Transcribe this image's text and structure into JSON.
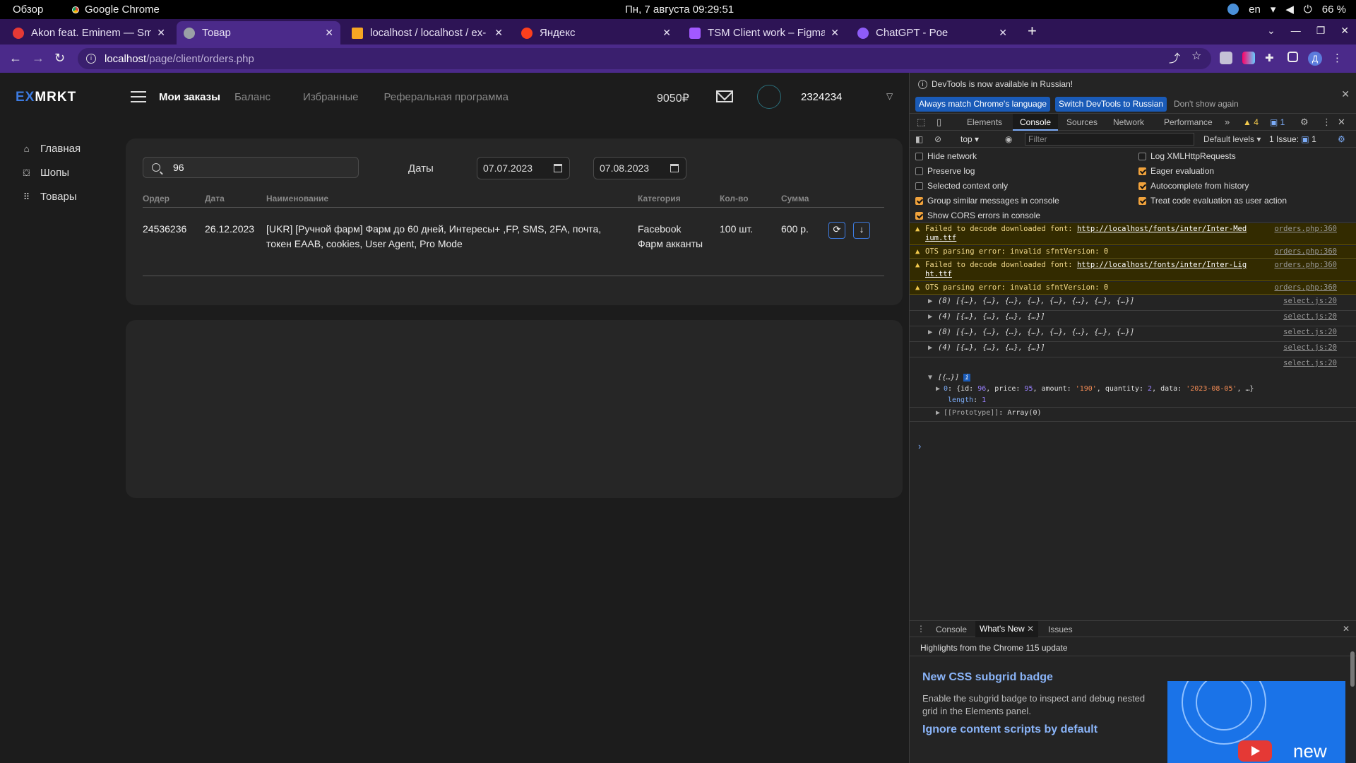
{
  "os": {
    "overview": "Обзор",
    "app_name": "Google Chrome",
    "clock": "Пн, 7 августа  09:29:51",
    "lang": "en",
    "battery": "66 %"
  },
  "tabs": [
    {
      "title": "Akon feat. Eminem — Sm",
      "favicon_color": "#e53935"
    },
    {
      "title": "Товар",
      "favicon_color": "#9aa0a6"
    },
    {
      "title": "localhost / localhost / ex-",
      "favicon_color": "#f6a623"
    },
    {
      "title": "Яндекс",
      "favicon_color": "#fc3f1d"
    },
    {
      "title": "TSM Client work – Figma",
      "favicon_color": "#a259ff"
    },
    {
      "title": "ChatGPT - Poe",
      "favicon_color": "#8e5cf7"
    }
  ],
  "address": {
    "host": "localhost",
    "path": "/page/client/orders.php"
  },
  "site": {
    "logo_ex": "EX",
    "logo_rest": "MRKT",
    "nav": [
      "Мои заказы",
      "Баланс",
      "Избранные",
      "Реферальная программа"
    ],
    "balance": "9050₽",
    "username": "2324234",
    "sidebar": [
      {
        "label": "Главная",
        "icon": "home-icon"
      },
      {
        "label": "Шопы",
        "icon": "bag-icon"
      },
      {
        "label": "Товары",
        "icon": "grid-icon"
      }
    ]
  },
  "orders": {
    "search_value": "96",
    "dates_label": "Даты",
    "date_from": "07.07.2023",
    "date_to": "07.08.2023",
    "columns": [
      "Ордер",
      "Дата",
      "Наименование",
      "Категория",
      "Кол-во",
      "Сумма"
    ],
    "rows": [
      {
        "order": "24536236",
        "date": "26.12.2023",
        "name_line1": "[UKR] [Ручной фарм] Фарм до 60 дней, Интересы+ ,FP, SMS, 2FA, почта,",
        "name_line2": "токен EAAB, cookies, User Agent, Pro Mode",
        "category_line1": "Facebook",
        "category_line2": "Фарм акканты",
        "qty": "100 шт.",
        "sum": "600 р."
      }
    ]
  },
  "devtools": {
    "banner": "DevTools is now available in Russian!",
    "btn_match": "Always match Chrome's language",
    "btn_switch": "Switch DevTools to Russian",
    "btn_dismiss": "Don't show again",
    "tabs": [
      "Elements",
      "Console",
      "Sources",
      "Network",
      "Performance"
    ],
    "warn_count": "4",
    "info_count": "1",
    "context": "top",
    "filter_placeholder": "Filter",
    "levels": "Default levels",
    "issues": "1 Issue:",
    "issues_count": "1",
    "settings_left": [
      {
        "label": "Hide network",
        "checked": false
      },
      {
        "label": "Preserve log",
        "checked": false
      },
      {
        "label": "Selected context only",
        "checked": false
      },
      {
        "label": "Group similar messages in console",
        "checked": true
      },
      {
        "label": "Show CORS errors in console",
        "checked": true
      }
    ],
    "settings_right": [
      {
        "label": "Log XMLHttpRequests",
        "checked": false
      },
      {
        "label": "Eager evaluation",
        "checked": true
      },
      {
        "label": "Autocomplete from history",
        "checked": true
      },
      {
        "label": "Treat code evaluation as user action",
        "checked": true
      }
    ],
    "warnings": [
      {
        "text": "Failed to decode downloaded font: ",
        "url": "http://localhost/fonts/inter/Inter-Med",
        "url2": "ium.ttf",
        "src": "orders.php:360"
      },
      {
        "text": "OTS parsing error: invalid sfntVersion: 0",
        "src": "orders.php:360"
      },
      {
        "text": "Failed to decode downloaded font: ",
        "url": "http://localhost/fonts/inter/Inter-Lig",
        "url2": "ht.ttf",
        "src": "orders.php:360"
      },
      {
        "text": "OTS parsing error: invalid sfntVersion: 0",
        "src": "orders.php:360"
      }
    ],
    "logs": [
      {
        "text": "(8) [{…}, {…}, {…}, {…}, {…}, {…}, {…}, {…}]",
        "src": "select.js:20"
      },
      {
        "text": "(4) [{…}, {…}, {…}, {…}]",
        "src": "select.js:20"
      },
      {
        "text": "(8) [{…}, {…}, {…}, {…}, {…}, {…}, {…}, {…}]",
        "src": "select.js:20"
      },
      {
        "text": "(4) [{…}, {…}, {…}, {…}]",
        "src": "select.js:20"
      },
      {
        "text": "",
        "src": "select.js:20"
      }
    ],
    "tree_root": "[{…}]",
    "tree_item_key": "0",
    "tree_item_open": "{id: ",
    "tree_id": "96",
    "tree_price_label": ", price: ",
    "tree_price": "95",
    "tree_amount_label": ", amount: ",
    "tree_amount": "'190'",
    "tree_qty_label": ", quantity: ",
    "tree_qty": "2",
    "tree_data_label": ", data: ",
    "tree_data": "'2023-08-05'",
    "tree_item_close": ", …}",
    "tree_length_label": "length",
    "tree_length": "1",
    "tree_proto": "[[Prototype]]",
    "tree_proto_val": "Array(0)",
    "drawer_tabs": [
      "Console",
      "What's New",
      "Issues"
    ],
    "whats_new_highlights": "Highlights from the Chrome 115 update",
    "feature1_title": "New CSS subgrid badge",
    "feature1_desc": "Enable the subgrid badge to inspect and debug nested grid in the Elements panel.",
    "feature2_title": "Ignore content scripts by default",
    "promo_text": "new"
  }
}
